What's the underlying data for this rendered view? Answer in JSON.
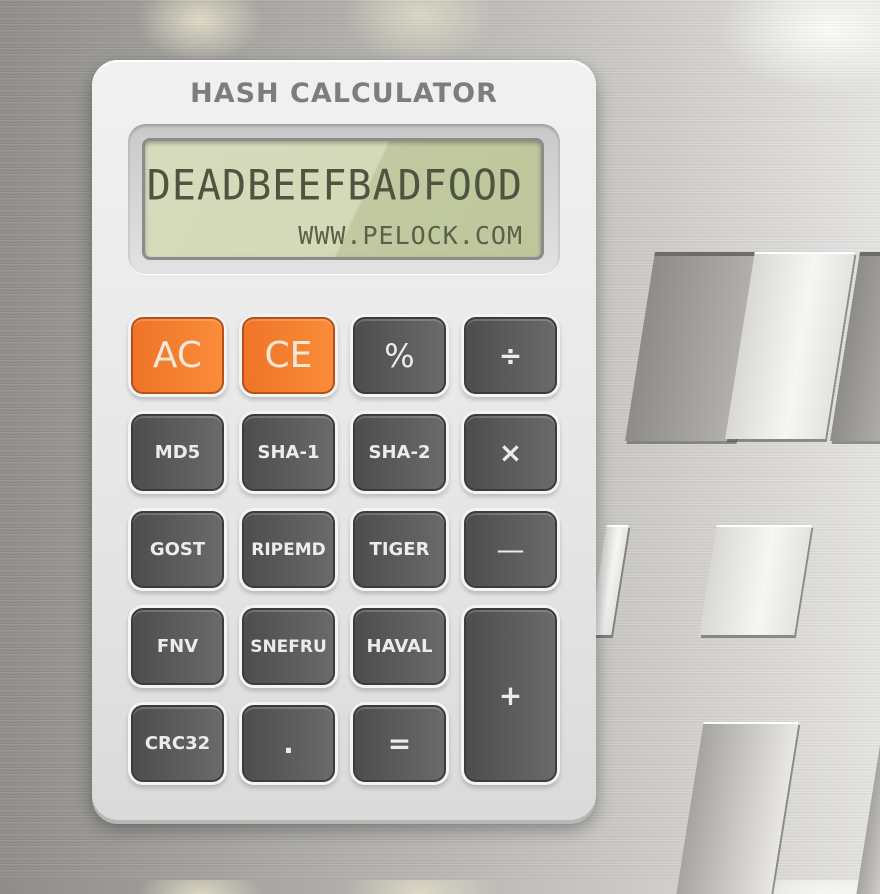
{
  "app": {
    "title": "HASH CALCULATOR"
  },
  "display": {
    "main_value": "DEADBEEFBADFOOD",
    "sub_text": "WWW.PELOCK.COM",
    "colors": {
      "lcd_background": "#c8d0aa",
      "lcd_text": "#4e5440"
    }
  },
  "keys": {
    "ac": "AC",
    "ce": "CE",
    "percent": "%",
    "divide": "÷",
    "md5": "MD5",
    "sha1": "SHA-1",
    "sha2": "SHA-2",
    "multiply": "×",
    "gost": "GOST",
    "ripemd": "RIPEMD",
    "tiger": "TIGER",
    "minus": "—",
    "fnv": "FNV",
    "snefru": "SNEFRU",
    "haval": "HAVAL",
    "plus": "+",
    "crc32": "CRC32",
    "dot": ".",
    "equals": "="
  },
  "colors": {
    "accent_key": "#f47f30",
    "dark_key": "#5a5a5a",
    "body": "#e8e8e8",
    "title_text": "#7d7d7d"
  }
}
